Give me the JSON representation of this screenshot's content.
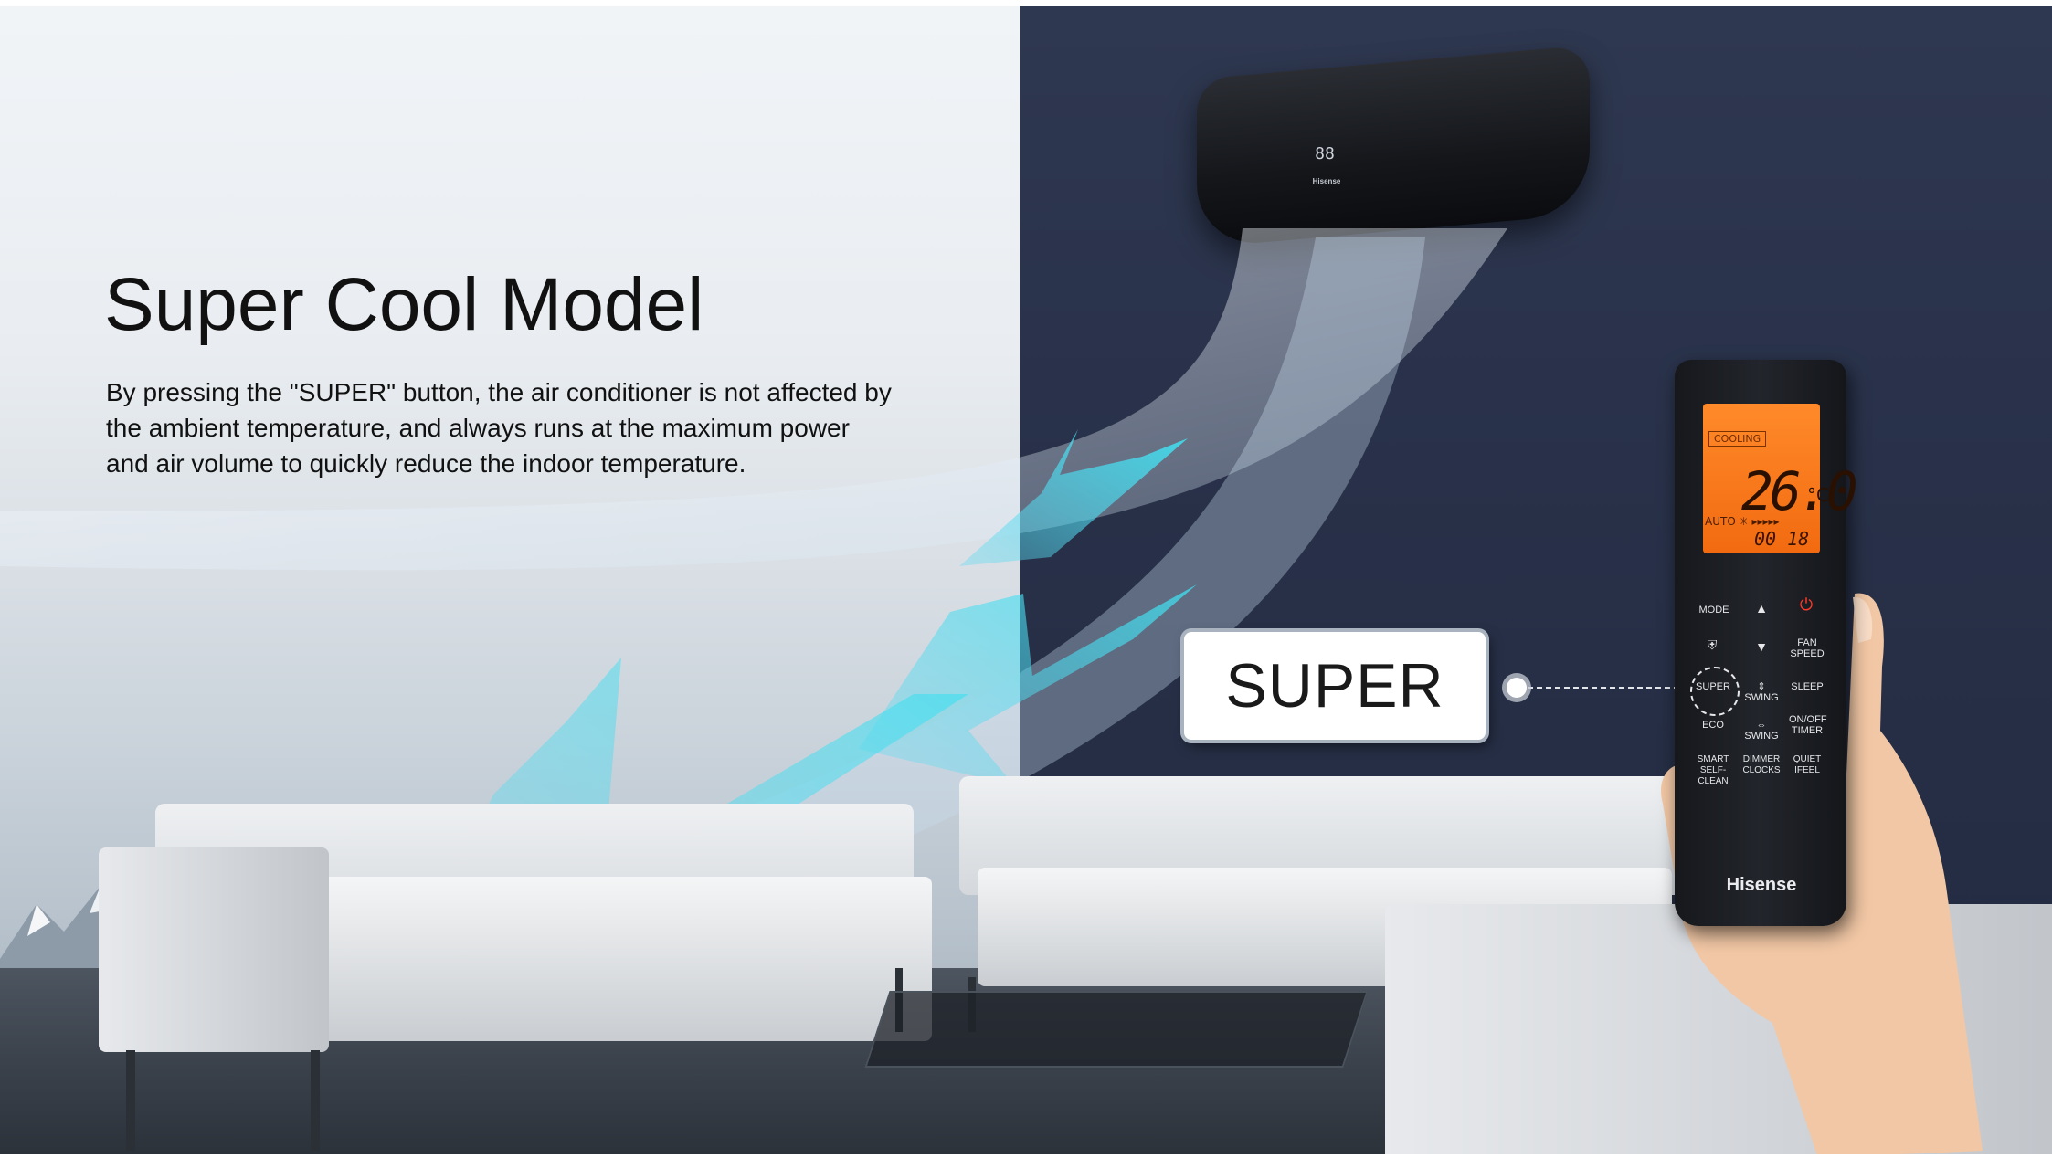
{
  "slide": {
    "title": "Super Cool Model",
    "description": "By pressing the \"SUPER\" button, the air conditioner is not affected by the ambient temperature, and always runs at the maximum power and air volume to quickly reduce the indoor temperature."
  },
  "callout": {
    "label": "SUPER"
  },
  "ac_unit": {
    "display": "88",
    "brand": "Hisense"
  },
  "remote": {
    "brand": "Hisense",
    "lcd": {
      "mode": "COOLING",
      "temperature": "26.0",
      "unit": "°C",
      "fan": "AUTO ✳ ▸▸▸▸▸",
      "timer": "00 18"
    },
    "buttons": {
      "mode": "MODE",
      "up": "▲",
      "power": "⏻",
      "down": "▼",
      "fan_speed": "FAN SPEED",
      "super": "SUPER",
      "swing_v": "⇕ SWING",
      "sleep": "SLEEP",
      "eco": "ECO",
      "swing_h": "⇔ SWING",
      "onoff_timer": "ON/OFF TIMER",
      "smart": "SMART SELF-CLEAN",
      "dimmer": "DIMMER CLOCKS",
      "quiet": "QUIET IFEEL"
    }
  },
  "colors": {
    "wall": "#283149",
    "sky": "#e9edf1",
    "airflow": "#3fe0f0",
    "lcd": "#f26a10",
    "title_text": "#111111"
  }
}
